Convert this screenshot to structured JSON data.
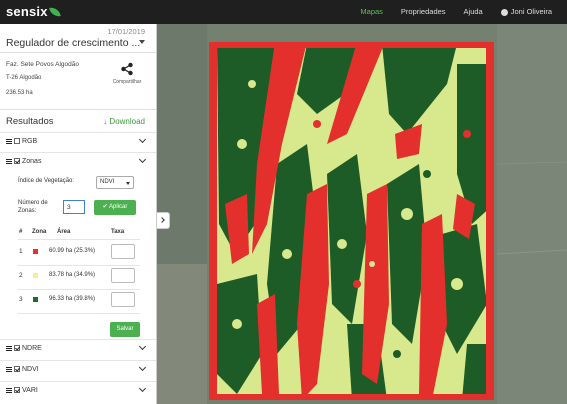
{
  "app": {
    "logo": "sensix"
  },
  "nav": {
    "items": [
      {
        "label": "Mapas",
        "active": true
      },
      {
        "label": "Propriedades",
        "active": false
      },
      {
        "label": "Ajuda",
        "active": false
      }
    ],
    "user": "Joni Oliveira"
  },
  "sidebar": {
    "date": "17/01/2019",
    "product": "Regulador de crescimento ...",
    "farm": "Faz. Sete Povos Algodão",
    "plot": "T-26 Algodão",
    "area": "236.53 ha",
    "share_label": "Compartilhar",
    "results_title": "Resultados",
    "download_label": "↓ Download"
  },
  "layers": {
    "rgb": {
      "label": "RGB",
      "checked": false
    },
    "zonas": {
      "label": "Zonas",
      "checked": true
    },
    "ndre": {
      "label": "NDRE",
      "checked": true
    },
    "ndvi": {
      "label": "NDVI",
      "checked": true
    },
    "vari": {
      "label": "VARI",
      "checked": true
    }
  },
  "zonas_panel": {
    "vi_label": "Índice de Vegetação:",
    "vi_value": "NDVI",
    "nz_label": "Número de Zonas:",
    "nz_value": "3",
    "apply_label": "✔ Aplicar",
    "table_headers": {
      "num": "#",
      "zone": "Zona",
      "area": "Área",
      "rate": "Taxa"
    },
    "rows": [
      {
        "num": "1",
        "color": "#e8312d",
        "area": "60.99 ha (25.3%)"
      },
      {
        "num": "2",
        "color": "#f0ef9a",
        "area": "83.78 ha (34.9%)"
      },
      {
        "num": "3",
        "color": "#1f6b2a",
        "area": "96.33 ha (39.8%)"
      }
    ],
    "save_label": "Salvar"
  },
  "colors": {
    "accent": "#4caf50",
    "zone_red": "#e8312d",
    "zone_yellow": "#d7e88b",
    "zone_green": "#1f5e26"
  }
}
